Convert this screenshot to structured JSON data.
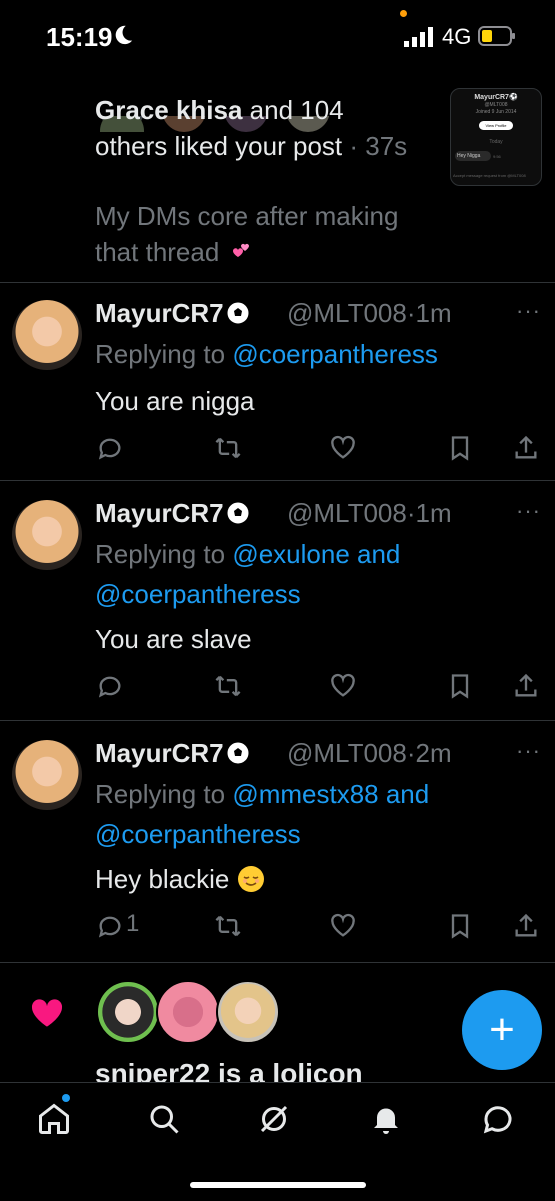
{
  "status_bar": {
    "time": "15:19",
    "network": "4G"
  },
  "notification": {
    "actor": "Grace khisa",
    "text_rest": " and 104 others liked your post",
    "separator": " · ",
    "time": "37s",
    "quote": "My DMs core after making that thread",
    "thumb": {
      "name": "MayurCR7⚽",
      "handle": "@MLT008",
      "joined": "Joined 9 Jun 2014",
      "button": "View Profile",
      "day": "Today",
      "message": "Hey Nigga",
      "msg_time": "9:56",
      "footer": "Accept message request from @MLT008"
    }
  },
  "tweets": [
    {
      "name": "MayurCR7",
      "handle": "@MLT008·1m",
      "replying_prefix": "Replying to ",
      "mentions": [
        "@coerpantheress"
      ],
      "joiner": "",
      "body": "You are nigga",
      "reply_count": ""
    },
    {
      "name": "MayurCR7",
      "handle": "@MLT008·1m",
      "replying_prefix": "Replying to ",
      "mentions": [
        "@exulone and",
        "@coerpantheress"
      ],
      "body": "You are slave",
      "reply_count": ""
    },
    {
      "name": "MayurCR7",
      "handle": "@MLT008·2m",
      "replying_prefix": "Replying to ",
      "mentions": [
        "@mmestx88 and",
        "@coerpantheress"
      ],
      "body": "Hey blackie",
      "reply_count": "1"
    }
  ],
  "more_label": "···",
  "like_notification": {
    "text": "sniper22 is a lolicon"
  },
  "fab_label": "+",
  "colors": {
    "accent": "#1d9bf0",
    "like": "#f91880",
    "muted": "#71767b",
    "divider": "#2f3336"
  },
  "icons": {
    "actions": [
      "reply-icon",
      "retweet-icon",
      "like-icon",
      "bookmark-icon",
      "share-icon"
    ],
    "tabs": [
      "home-icon",
      "search-icon",
      "grok-icon",
      "notifications-icon",
      "messages-icon"
    ]
  }
}
